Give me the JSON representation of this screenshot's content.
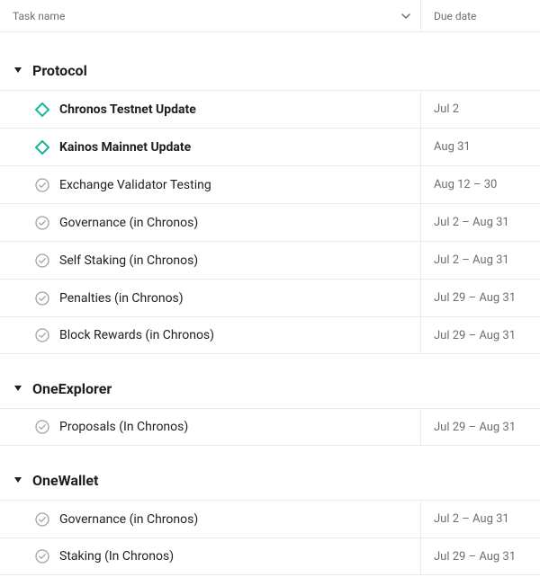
{
  "columns": {
    "task_name": "Task name",
    "due_date": "Due date"
  },
  "sections": [
    {
      "title": "Protocol",
      "tasks": [
        {
          "name": "Chronos Testnet Update",
          "due": "Jul 2",
          "milestone": true
        },
        {
          "name": "Kainos Mainnet Update",
          "due": "Aug 31",
          "milestone": true
        },
        {
          "name": "Exchange Validator Testing",
          "due": "Aug 12 – 30",
          "milestone": false
        },
        {
          "name": "Governance (in Chronos)",
          "due": "Jul 2 – Aug 31",
          "milestone": false
        },
        {
          "name": "Self Staking (in Chronos)",
          "due": "Jul 2 – Aug 31",
          "milestone": false
        },
        {
          "name": "Penalties (in Chronos)",
          "due": "Jul 29 – Aug 31",
          "milestone": false
        },
        {
          "name": "Block Rewards (in Chronos)",
          "due": "Jul 29 – Aug 31",
          "milestone": false
        }
      ]
    },
    {
      "title": "OneExplorer",
      "tasks": [
        {
          "name": "Proposals (In Chronos)",
          "due": "Jul 29 – Aug 31",
          "milestone": false
        }
      ]
    },
    {
      "title": "OneWallet",
      "tasks": [
        {
          "name": "Governance (in Chronos)",
          "due": "Jul 2 – Aug 31",
          "milestone": false
        },
        {
          "name": "Staking (In Chronos)",
          "due": "Jul 29 – Aug 31",
          "milestone": false
        }
      ]
    }
  ]
}
